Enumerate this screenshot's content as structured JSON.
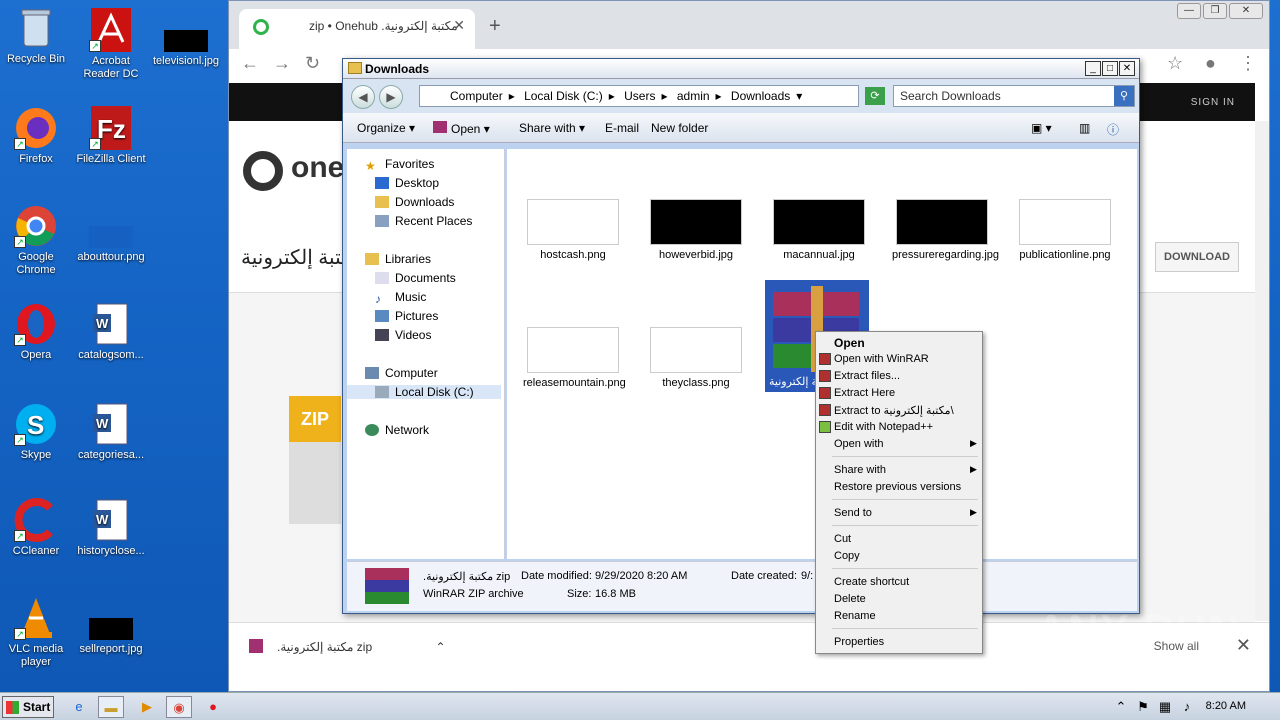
{
  "desktop": {
    "icons": [
      {
        "label": "Recycle Bin"
      },
      {
        "label": "Acrobat Reader DC"
      },
      {
        "label": "televisionl.jpg"
      },
      {
        "label": "Firefox"
      },
      {
        "label": "FileZilla Client"
      },
      {
        "label": "Google Chrome"
      },
      {
        "label": "abouttour.png"
      },
      {
        "label": "Opera"
      },
      {
        "label": "catalogsom..."
      },
      {
        "label": "Skype"
      },
      {
        "label": "categoriesa..."
      },
      {
        "label": "CCleaner"
      },
      {
        "label": "historyclose..."
      },
      {
        "label": "VLC media player"
      },
      {
        "label": "sellreport.jpg"
      }
    ]
  },
  "chrome": {
    "tab_title": "zip • Onehub .مكتبة إلكترونية",
    "site": {
      "brand": "one",
      "signin": "SIGN IN",
      "page_title": "مكتبة إلكترونية",
      "download_button": "DOWNLOAD",
      "zip_label": "ZIP"
    },
    "download_bar": {
      "item": ".مكتبة إلكترونية zip",
      "show_all": "Show all"
    }
  },
  "explorer": {
    "title": "Downloads",
    "breadcrumb": [
      "Computer",
      "Local Disk (C:)",
      "Users",
      "admin",
      "Downloads"
    ],
    "search_placeholder": "Search Downloads",
    "commands": {
      "organize": "Organize",
      "open": "Open",
      "share_with": "Share with",
      "email": "E-mail",
      "new_folder": "New folder"
    },
    "nav": {
      "favorites": "Favorites",
      "desktop": "Desktop",
      "downloads": "Downloads",
      "recent": "Recent Places",
      "libraries": "Libraries",
      "documents": "Documents",
      "music": "Music",
      "pictures": "Pictures",
      "videos": "Videos",
      "computer": "Computer",
      "local_disk": "Local Disk (C:)",
      "network": "Network"
    },
    "files": [
      {
        "name": "hostcash.png"
      },
      {
        "name": "howeverbid.jpg"
      },
      {
        "name": "macannual.jpg"
      },
      {
        "name": "pressureregarding.jpg"
      },
      {
        "name": "publicationline.png"
      },
      {
        "name": "releasemountain.png"
      },
      {
        "name": "theyclass.png"
      },
      {
        "name": "مكتبة إلكترونية"
      }
    ],
    "status": {
      "filename": ".مكتبة إلكترونية zip",
      "date_modified_label": "Date modified:",
      "date_modified": "9/29/2020 8:20 AM",
      "date_created_label": "Date created:",
      "date_created": "9/:",
      "type": "WinRAR ZIP archive",
      "size_label": "Size:",
      "size": "16.8 MB"
    }
  },
  "context_menu": {
    "open": "Open",
    "open_winrar": "Open with WinRAR",
    "extract_files": "Extract files...",
    "extract_here": "Extract Here",
    "extract_to": "Extract to مكتبة إلكترونية\\",
    "edit_notepad": "Edit with Notepad++",
    "open_with": "Open with",
    "share_with": "Share with",
    "restore": "Restore previous versions",
    "send_to": "Send to",
    "cut": "Cut",
    "copy": "Copy",
    "create_shortcut": "Create shortcut",
    "delete": "Delete",
    "rename": "Rename",
    "properties": "Properties"
  },
  "taskbar": {
    "start": "Start",
    "clock": "8:20 AM"
  },
  "watermark": "ANY RUN"
}
